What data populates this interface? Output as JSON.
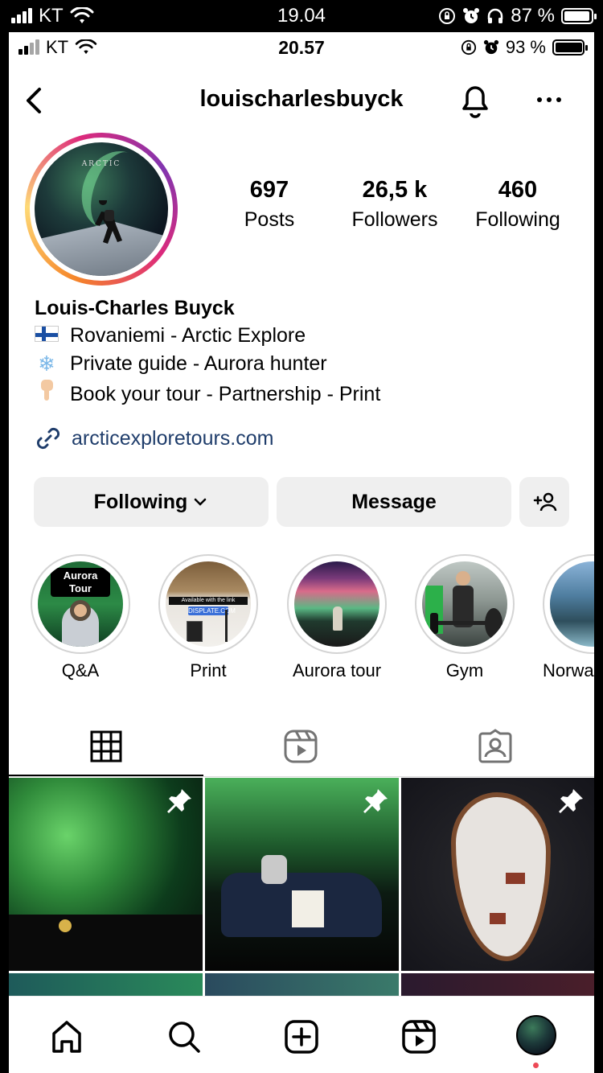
{
  "outer_status": {
    "carrier": "KT",
    "time": "19.04",
    "battery": "87 %",
    "battery_level": 0.87
  },
  "inner_status": {
    "carrier": "KT",
    "time": "20.57",
    "battery": "93 %",
    "battery_level": 0.93
  },
  "header": {
    "username": "louischarlesbuyck"
  },
  "profile": {
    "avatar_text": "ARCTIC",
    "stats": [
      {
        "value": "697",
        "label": "Posts"
      },
      {
        "value": "26,5 k",
        "label": "Followers"
      },
      {
        "value": "460",
        "label": "Following"
      }
    ],
    "name": "Louis-Charles Buyck",
    "bio": [
      {
        "icon": "finland-flag",
        "text": "Rovaniemi - Arctic Explore"
      },
      {
        "icon": "snowflake",
        "text": "Private guide - Aurora hunter"
      },
      {
        "icon": "pointing-down-hand",
        "text": "Book your tour - Partnership - Print"
      }
    ],
    "link": "arcticexploretours.com"
  },
  "actions": {
    "following": "Following",
    "message": "Message"
  },
  "highlights": [
    {
      "label": "Q&A",
      "overlay": "Aurora Tour"
    },
    {
      "label": "Print",
      "overlay": "Available with the link",
      "overlay2": "DISPLATE.COM"
    },
    {
      "label": "Aurora tour"
    },
    {
      "label": "Gym"
    },
    {
      "label": "Norwa"
    }
  ],
  "tabs": [
    "grid",
    "reels",
    "tagged"
  ],
  "bottom_nav": [
    "home",
    "search",
    "create",
    "reels",
    "profile"
  ],
  "colors": {
    "link": "#1f3d6b",
    "button_bg": "#efefef",
    "notification_dot": "#ed4956"
  }
}
